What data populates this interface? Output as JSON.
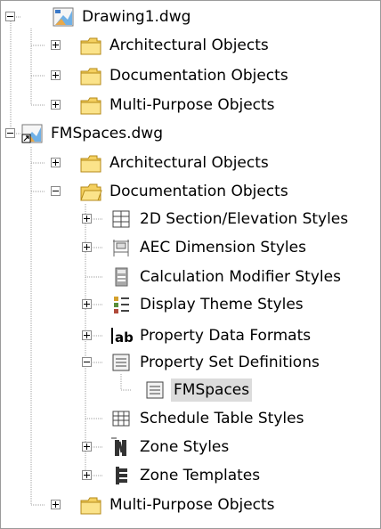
{
  "tree": {
    "drawing1": {
      "label": "Drawing1.dwg",
      "icon": "drawing-file-icon",
      "children": [
        {
          "label": "Architectural Objects",
          "icon": "folder-icon"
        },
        {
          "label": "Documentation Objects",
          "icon": "folder-icon"
        },
        {
          "label": "Multi-Purpose Objects",
          "icon": "folder-icon"
        }
      ]
    },
    "fmspaces": {
      "label": "FMSpaces.dwg",
      "icon": "drawing-file-shortcut-icon",
      "children": [
        {
          "label": "Architectural Objects",
          "icon": "folder-icon"
        },
        {
          "label": "Documentation Objects",
          "icon": "folder-icon",
          "children": [
            {
              "label": "2D Section/Elevation Styles",
              "icon": "section-elevation-icon"
            },
            {
              "label": "AEC Dimension Styles",
              "icon": "dimension-style-icon"
            },
            {
              "label": "Calculation Modifier Styles",
              "icon": "calculation-modifier-icon"
            },
            {
              "label": "Display Theme Styles",
              "icon": "display-theme-icon"
            },
            {
              "label": "Property Data Formats",
              "icon": "ab-format-icon"
            },
            {
              "label": "Property Set Definitions",
              "icon": "property-set-icon",
              "children": [
                {
                  "label": "FMSpaces",
                  "icon": "property-set-icon",
                  "selected": true
                }
              ]
            },
            {
              "label": "Schedule Table Styles",
              "icon": "schedule-table-icon"
            },
            {
              "label": "Zone Styles",
              "icon": "zone-style-icon"
            },
            {
              "label": "Zone Templates",
              "icon": "zone-template-icon"
            }
          ]
        },
        {
          "label": "Multi-Purpose Objects",
          "icon": "folder-icon"
        }
      ]
    }
  },
  "colors": {
    "folder": "#f4d060",
    "selection": "#dcdcdc",
    "tree_line": "#a0a0a0"
  }
}
